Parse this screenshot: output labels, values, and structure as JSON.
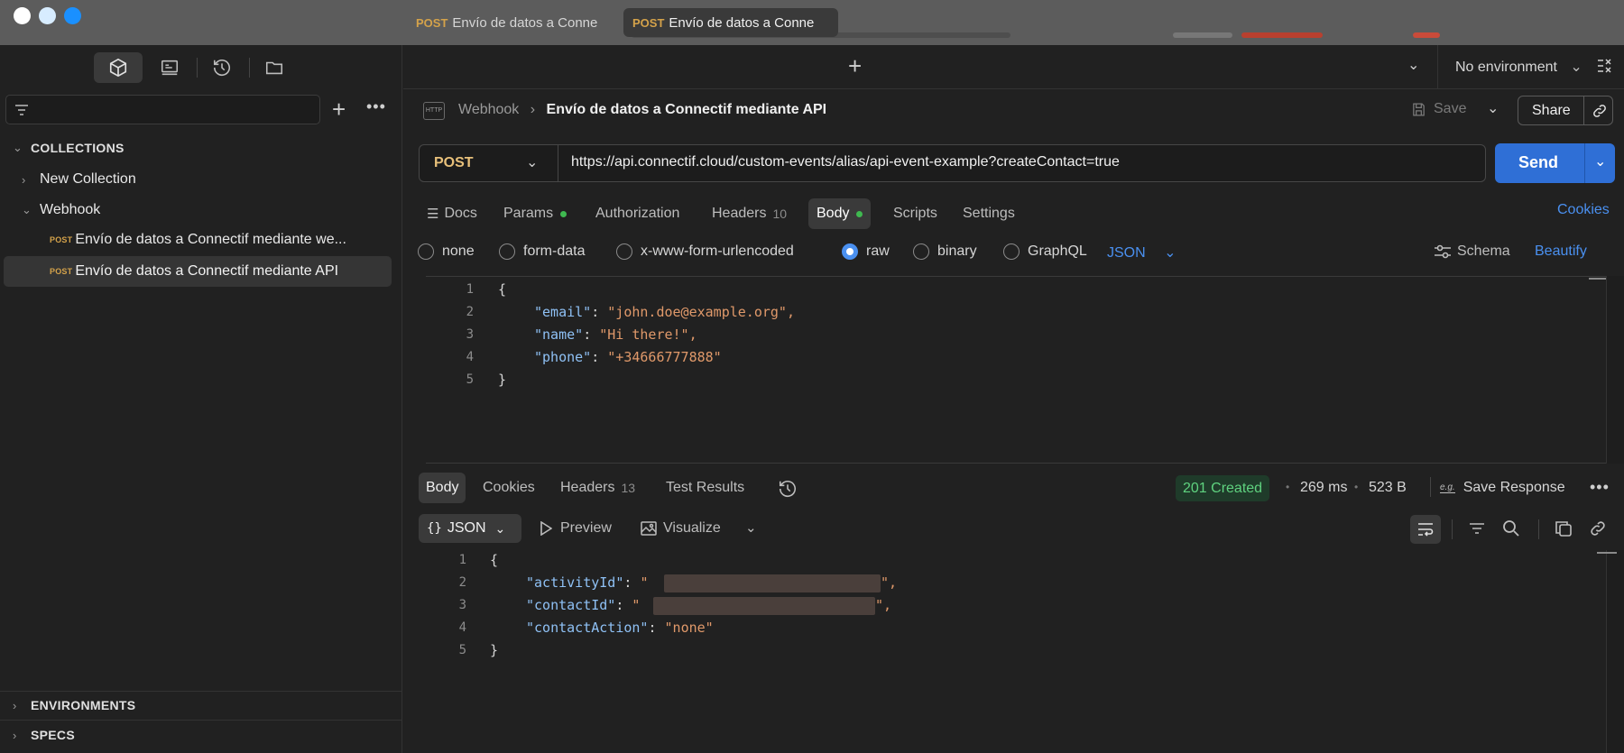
{
  "window": {
    "traffic_lights": [
      "#ffffff",
      "#d7ecff",
      "#1a90ff"
    ]
  },
  "sidebar": {
    "icons": [
      "collections-icon",
      "apis-icon",
      "history-icon",
      "folder-icon"
    ],
    "sections": {
      "collections": "COLLECTIONS",
      "environments": "ENVIRONMENTS",
      "specs": "SPECS"
    },
    "tree": [
      {
        "label": "New Collection"
      },
      {
        "label": "Webhook"
      },
      {
        "method": "POST",
        "label": "Envío de datos a Connectif mediante we..."
      },
      {
        "method": "POST",
        "label": "Envío de datos a Connectif mediante API"
      }
    ]
  },
  "tabs": [
    {
      "method": "POST",
      "label": "Envío de datos a Conne"
    },
    {
      "method": "POST",
      "label": "Envío de datos a Conne"
    }
  ],
  "environment": "No environment",
  "breadcrumb": {
    "parent": "Webhook",
    "current": "Envío de datos a Connectif mediante API"
  },
  "actions": {
    "save": "Save",
    "share": "Share"
  },
  "request": {
    "method": "POST",
    "url": "https://api.connectif.cloud/custom-events/alias/api-event-example?createContact=true",
    "send": "Send"
  },
  "request_tabs": [
    {
      "label": "Docs"
    },
    {
      "label": "Params"
    },
    {
      "label": "Authorization"
    },
    {
      "label": "Headers",
      "count": "10"
    },
    {
      "label": "Body"
    },
    {
      "label": "Scripts"
    },
    {
      "label": "Settings"
    }
  ],
  "cookies_link": "Cookies",
  "body_types": [
    "none",
    "form-data",
    "x-www-form-urlencoded",
    "raw",
    "binary",
    "GraphQL"
  ],
  "body_format": "JSON",
  "schema": "Schema",
  "beautify": "Beautify",
  "request_body": {
    "line_numbers": [
      "1",
      "2",
      "3",
      "4",
      "5"
    ],
    "open": "{",
    "close": "}",
    "fields": [
      {
        "key": "\"email\"",
        "value": "\"john.doe@example.org\","
      },
      {
        "key": "\"name\"",
        "value": "\"Hi there!\","
      },
      {
        "key": "\"phone\"",
        "value": "\"+34666777888\""
      }
    ]
  },
  "response_tabs": [
    {
      "label": "Body"
    },
    {
      "label": "Cookies"
    },
    {
      "label": "Headers",
      "count": "13"
    },
    {
      "label": "Test Results"
    }
  ],
  "response_meta": {
    "status": "201 Created",
    "time": "269 ms",
    "size": "523 B",
    "save": "Save Response",
    "status_color": "#3fb950"
  },
  "response_view": {
    "format": "JSON",
    "preview": "Preview",
    "visualize": "Visualize"
  },
  "response_body": {
    "line_numbers": [
      "1",
      "2",
      "3",
      "4",
      "5"
    ],
    "open": "{",
    "close": "}",
    "fields": [
      {
        "key": "\"activityId\"",
        "value": "\""
      },
      {
        "key": "\"contactId\"",
        "value": "\""
      },
      {
        "key": "\"contactAction\"",
        "value": "\"none\""
      }
    ]
  },
  "colors": {
    "accent": "#2f6fd6",
    "method": "#d4a24a",
    "link": "#4a90f0"
  }
}
